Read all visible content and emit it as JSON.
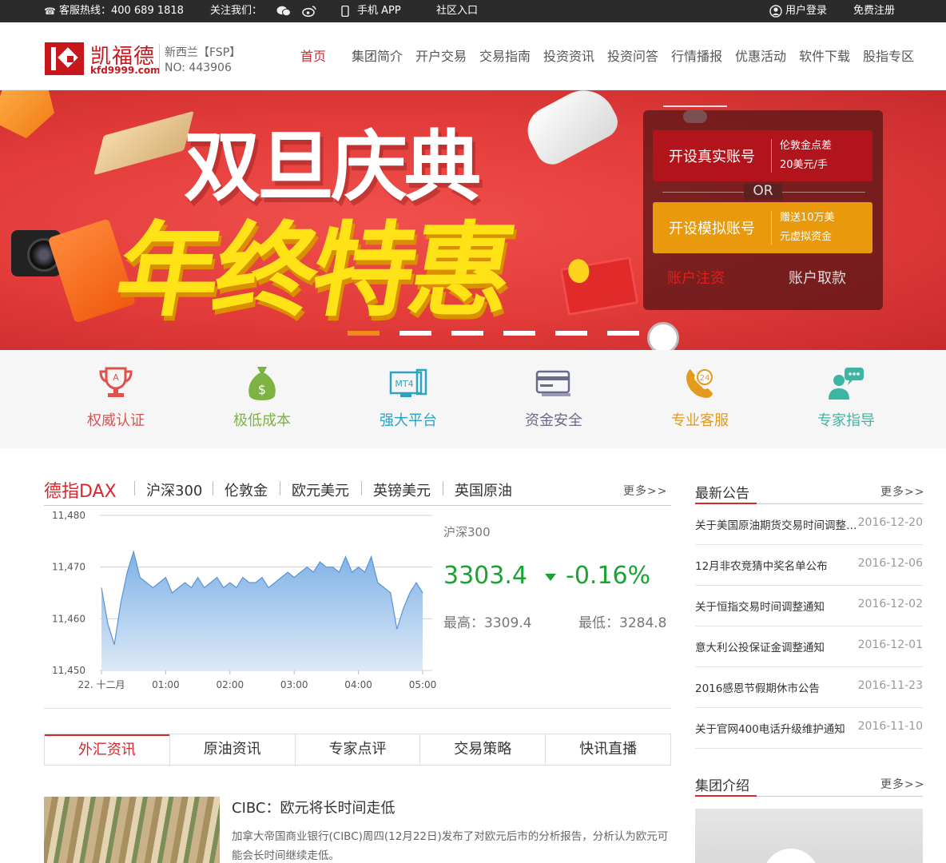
{
  "topbar": {
    "hotline": "客服热线：400 689 1818",
    "follow": "关注我们：",
    "app": "手机 APP",
    "community": "社区入口",
    "login": "用户登录",
    "register": "免费注册"
  },
  "header": {
    "logo_name": "凯福德",
    "logo_url": "kfd9999.com",
    "reg_line1": "新西兰【FSP】",
    "reg_line2": "NO: 443906",
    "nav": [
      "首页",
      "集团简介",
      "开户交易",
      "交易指南",
      "投资资讯",
      "投资问答",
      "行情播报",
      "优惠活动",
      "软件下载",
      "股指专区"
    ]
  },
  "banner": {
    "headline1": "双旦庆典",
    "headline2": "年终特惠",
    "slides": 6,
    "active_slide": 1,
    "panel": {
      "real_label": "开设真实账号",
      "real_desc1": "伦敦金点差",
      "real_desc2": "20美元/手",
      "or": "OR",
      "demo_label": "开设模拟账号",
      "demo_desc1": "赠送10万美",
      "demo_desc2": "元虚拟资金",
      "deposit": "账户注资",
      "withdraw": "账户取款"
    }
  },
  "features": [
    {
      "label": "权威认证",
      "icon": "trophy-icon",
      "color": "#e0504f"
    },
    {
      "label": "极低成本",
      "icon": "money-bag-icon",
      "color": "#7cb342"
    },
    {
      "label": "强大平台",
      "icon": "mt4-platform-icon",
      "color": "#2aa3c4"
    },
    {
      "label": "资金安全",
      "icon": "card-safe-icon",
      "color": "#6a6a8c"
    },
    {
      "label": "专业客服",
      "icon": "24h-service-icon",
      "color": "#e49a1b"
    },
    {
      "label": "专家指导",
      "icon": "expert-chat-icon",
      "color": "#3cb5a3"
    }
  ],
  "colors": {
    "accent": "#d9272e",
    "up_down_green": "#1aa332"
  },
  "market": {
    "tabs": [
      "德指DAX",
      "沪深300",
      "伦敦金",
      "欧元美元",
      "英镑美元",
      "英国原油"
    ],
    "more": "更多>>",
    "quote_name": "沪深300",
    "quote_value": "3303.4",
    "quote_change": "-0.16%",
    "quote_high": "最高：3309.4",
    "quote_low": "最低：3284.8"
  },
  "chart_data": {
    "type": "area",
    "ylim": [
      11450,
      11480
    ],
    "yticks": [
      "11,480",
      "11,470",
      "11,460",
      "11,450"
    ],
    "xticks": [
      "22. 十二月",
      "01:00",
      "02:00",
      "03:00",
      "04:00",
      "05:00"
    ],
    "x": [
      0,
      0.1,
      0.2,
      0.3,
      0.4,
      0.5,
      0.6,
      0.7,
      0.8,
      0.9,
      1.0,
      1.1,
      1.2,
      1.3,
      1.4,
      1.5,
      1.6,
      1.7,
      1.8,
      1.9,
      2.0,
      2.1,
      2.2,
      2.3,
      2.4,
      2.5,
      2.6,
      2.7,
      2.8,
      2.9,
      3.0,
      3.1,
      3.2,
      3.3,
      3.4,
      3.5,
      3.6,
      3.7,
      3.8,
      3.9,
      4.0,
      4.1,
      4.2,
      4.3,
      4.4,
      4.5,
      4.6,
      4.7,
      4.8,
      4.9,
      5.0
    ],
    "values": [
      11466,
      11459,
      11455,
      11463,
      11469,
      11473,
      11468,
      11467,
      11466,
      11467,
      11468,
      11465,
      11466,
      11467,
      11466,
      11468,
      11466,
      11467,
      11468,
      11466,
      11467,
      11466,
      11468,
      11467,
      11467,
      11468,
      11466,
      11467,
      11468,
      11469,
      11468,
      11469,
      11470,
      11469,
      11471,
      11470,
      11470,
      11469,
      11472,
      11469,
      11470,
      11469,
      11472,
      11467,
      11466,
      11465,
      11458,
      11462,
      11465,
      11467,
      11465
    ]
  },
  "news_tabs": [
    "外汇资讯",
    "原油资讯",
    "专家点评",
    "交易策略",
    "快讯直播"
  ],
  "news": {
    "title": "CIBC：欧元将长时间走低",
    "desc": "加拿大帝国商业银行(CIBC)周四(12月22日)发布了对欧元后市的分析报告，分析认为欧元可能会长时间继续走低。"
  },
  "sidebar": {
    "announce_title": "最新公告",
    "more": "更多>>",
    "announcements": [
      {
        "title": "关于美国原油期货交易时间调整通知",
        "date": "2016-12-20"
      },
      {
        "title": "12月非农竞猜中奖名单公布",
        "date": "2016-12-06"
      },
      {
        "title": "关于恒指交易时间调整通知",
        "date": "2016-12-02"
      },
      {
        "title": "意大利公投保证金调整通知",
        "date": "2016-12-01"
      },
      {
        "title": "2016感恩节假期休市公告",
        "date": "2016-11-23"
      },
      {
        "title": "关于官网400电话升级维护通知",
        "date": "2016-11-10"
      }
    ],
    "group_title": "集团介绍"
  }
}
